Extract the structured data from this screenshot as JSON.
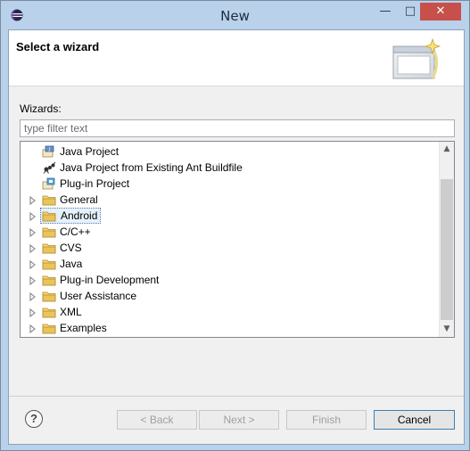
{
  "window": {
    "title": "New"
  },
  "titlebar": {
    "minimize": "—",
    "maximize": "□",
    "close": "✕"
  },
  "banner": {
    "title": "Select a wizard"
  },
  "wizards": {
    "label": "Wizards:",
    "filter_placeholder": "type filter text",
    "filter_value": ""
  },
  "tree": {
    "items": [
      {
        "label": "Java Project",
        "icon": "java-project-icon",
        "expandable": false,
        "selected": false
      },
      {
        "label": "Java Project from Existing Ant Buildfile",
        "icon": "ant-icon",
        "expandable": false,
        "selected": false
      },
      {
        "label": "Plug-in Project",
        "icon": "plugin-project-icon",
        "expandable": false,
        "selected": false
      },
      {
        "label": "General",
        "icon": "folder-icon",
        "expandable": true,
        "selected": false
      },
      {
        "label": "Android",
        "icon": "folder-icon",
        "expandable": true,
        "selected": true
      },
      {
        "label": "C/C++",
        "icon": "folder-icon",
        "expandable": true,
        "selected": false
      },
      {
        "label": "CVS",
        "icon": "folder-icon",
        "expandable": true,
        "selected": false
      },
      {
        "label": "Java",
        "icon": "folder-icon",
        "expandable": true,
        "selected": false
      },
      {
        "label": "Plug-in Development",
        "icon": "folder-icon",
        "expandable": true,
        "selected": false
      },
      {
        "label": "User Assistance",
        "icon": "folder-icon",
        "expandable": true,
        "selected": false
      },
      {
        "label": "XML",
        "icon": "folder-icon",
        "expandable": true,
        "selected": false
      },
      {
        "label": "Examples",
        "icon": "folder-icon",
        "expandable": true,
        "selected": false
      }
    ]
  },
  "buttons": {
    "help": "?",
    "back": "< Back",
    "next": "Next >",
    "finish": "Finish",
    "cancel": "Cancel"
  },
  "colors": {
    "titlebar": "#b9d1ea",
    "close_button": "#c7504b",
    "selection": "#e5f1fb",
    "folder": "#e8c55a"
  }
}
